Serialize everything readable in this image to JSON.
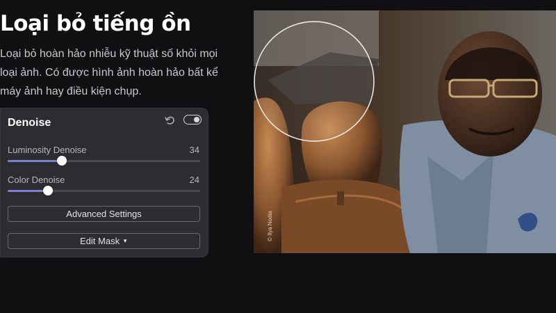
{
  "hero": {
    "title": "Loại bỏ tiếng ồn",
    "description": "Loại bỏ hoàn hảo nhiễu kỹ thuật số khỏi mọi loại ảnh. Có được hình ảnh hoàn hảo bất kể máy ảnh hay điều kiện chụp."
  },
  "panel": {
    "title": "Denoise",
    "enabled": true,
    "icons": [
      "undo-icon",
      "toggle-switch"
    ],
    "sliders": [
      {
        "label": "Luminosity Denoise",
        "value": "34",
        "fraction": 0.28
      },
      {
        "label": "Color Denoise",
        "value": "24",
        "fraction": 0.21
      }
    ],
    "advanced_label": "Advanced Settings",
    "edit_mask_label": "Edit Mask",
    "edit_mask_icon": "chevron-down-icon"
  },
  "photo": {
    "credit": "© Ilya Nodia",
    "lens_icon": "magnifier-circle"
  },
  "colors": {
    "background": "#101013",
    "panel": "#2d2d31",
    "accent": "#7d7fd1"
  }
}
